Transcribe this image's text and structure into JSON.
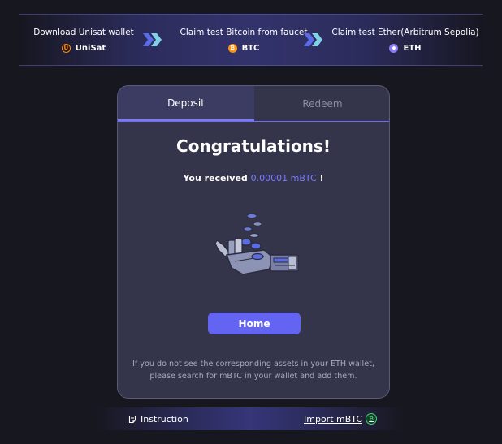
{
  "steps": [
    {
      "title": "Download Unisat wallet",
      "token": "UniSat",
      "icon": "unisat-icon",
      "icon_glyph": "U"
    },
    {
      "title": "Claim test Bitcoin from faucet",
      "token": "BTC",
      "icon": "bitcoin-icon",
      "icon_glyph": "₿"
    },
    {
      "title": "Claim test Ether(Arbitrum Sepolia)",
      "token": "ETH",
      "icon": "ethereum-icon",
      "icon_glyph": "◆"
    }
  ],
  "tabs": {
    "deposit": "Deposit",
    "redeem": "Redeem",
    "active": "Deposit"
  },
  "card": {
    "title": "Congratulations!",
    "received_prefix": "You received",
    "received_amount": "0.00001 mBTC",
    "received_suffix": "!",
    "home_label": "Home",
    "note": "If you do not see the corresponding assets in your ETH wallet, please search for mBTC in your wallet and add them."
  },
  "footer": {
    "instruction_label": "Instruction",
    "import_label": "Import mBTC"
  },
  "colors": {
    "accent": "#6464f2",
    "amount": "#7c7cff",
    "background": "#17171f",
    "card": "#34344a"
  }
}
